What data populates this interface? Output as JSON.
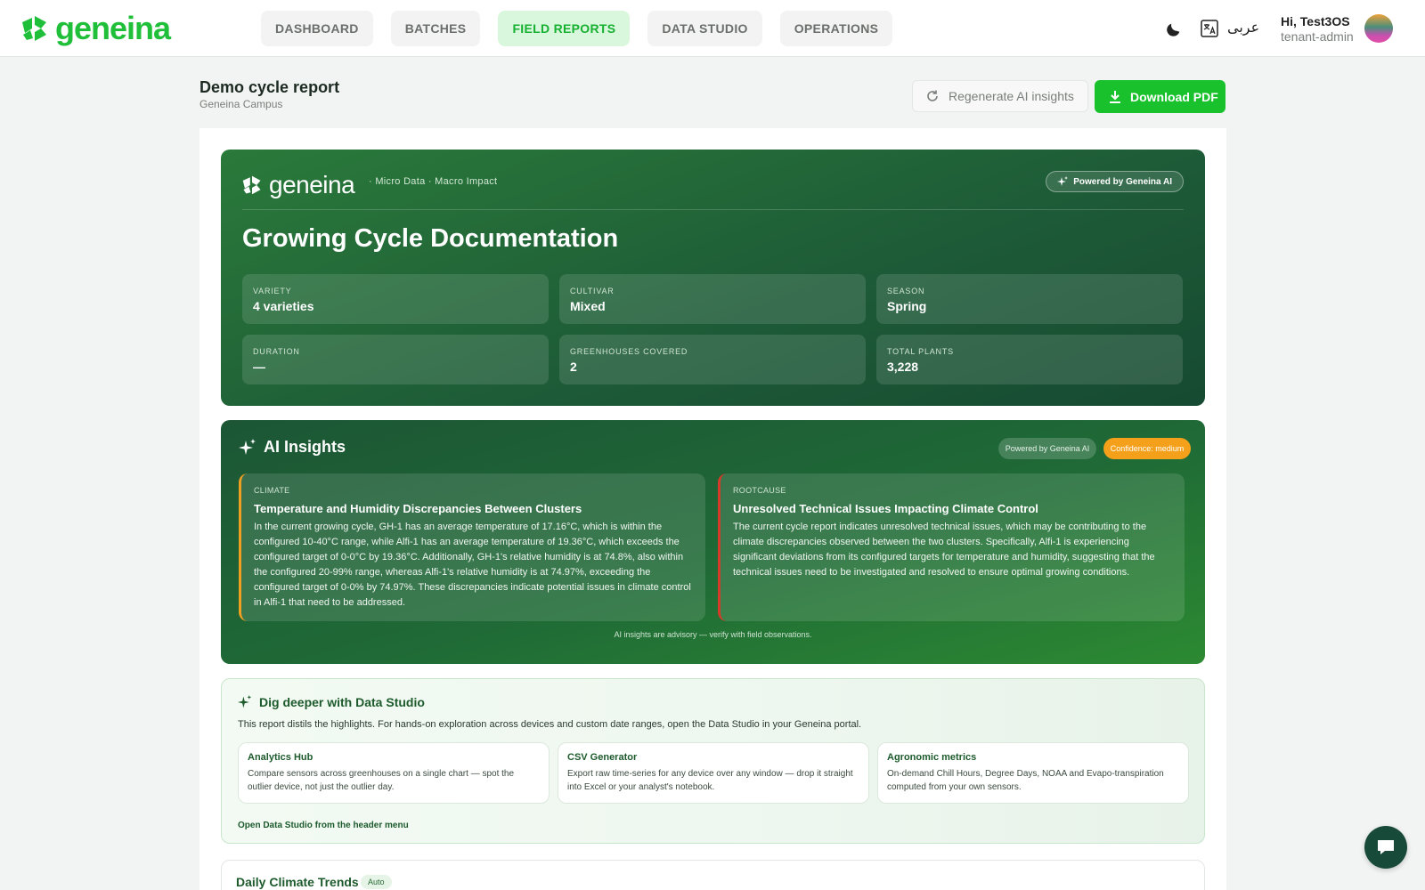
{
  "app": {
    "brand": "geneina",
    "nav": [
      {
        "label": "DASHBOARD"
      },
      {
        "label": "BATCHES"
      },
      {
        "label": "FIELD REPORTS",
        "active": true
      },
      {
        "label": "DATA STUDIO"
      },
      {
        "label": "OPERATIONS"
      }
    ],
    "language": "عربی",
    "user": {
      "greeting": "Hi, Test3OS",
      "role": "tenant-admin"
    },
    "accent": "#1fbf3a"
  },
  "page": {
    "title": "Demo cycle report",
    "subtitle": "Geneina Campus",
    "regen_label": "Regenerate AI insights",
    "pdf_label": "Download PDF"
  },
  "hero": {
    "brand": "geneina",
    "tagline": "· Micro Data · Macro Impact",
    "pill": "Powered by Geneina AI",
    "title": "Growing Cycle Documentation",
    "stats": [
      {
        "label": "VARIETY",
        "value": "4 varieties"
      },
      {
        "label": "CULTIVAR",
        "value": "Mixed"
      },
      {
        "label": "SEASON",
        "value": "Spring"
      },
      {
        "label": "DURATION",
        "value": "—"
      },
      {
        "label": "GREENHOUSES COVERED",
        "value": "2"
      },
      {
        "label": "TOTAL PLANTS",
        "value": "3,228"
      }
    ]
  },
  "ai": {
    "title": "AI Insights",
    "badge_powered": "Powered by Geneina AI",
    "badge_confidence": "Confidence: medium",
    "insights": [
      {
        "category": "CLIMATE",
        "title": "Temperature and Humidity Discrepancies Between Clusters",
        "body": "In the current growing cycle, GH-1 has an average temperature of 17.16°C, which is within the configured 10-40°C range, while Alfi-1 has an average temperature of 19.36°C, which exceeds the configured target of 0-0°C by 19.36°C. Additionally, GH-1's relative humidity is at 74.8%, also within the configured 20-99% range, whereas Alfi-1's relative humidity is at 74.97%, exceeding the configured target of 0-0% by 74.97%. These discrepancies indicate potential issues in climate control in Alfi-1 that need to be addressed."
      },
      {
        "category": "ROOTCAUSE",
        "title": "Unresolved Technical Issues Impacting Climate Control",
        "body": "The current cycle report indicates unresolved technical issues, which may be contributing to the climate discrepancies observed between the two clusters. Specifically, Alfi-1 is experiencing significant deviations from its configured targets for temperature and humidity, suggesting that the technical issues need to be investigated and resolved to ensure optimal growing conditions."
      }
    ],
    "footnote": "AI insights are advisory — verify with field observations."
  },
  "data_studio": {
    "title": "Dig deeper with Data Studio",
    "description": "This report distils the highlights. For hands-on exploration across devices and custom date ranges, open the Data Studio in your Geneina portal.",
    "cards": [
      {
        "title": "Analytics Hub",
        "body": "Compare sensors across greenhouses on a single chart — spot the outlier device, not just the outlier day."
      },
      {
        "title": "CSV Generator",
        "body": "Export raw time-series for any device over any window — drop it straight into Excel or your analyst's notebook."
      },
      {
        "title": "Agronomic metrics",
        "body": "On-demand Chill Hours, Degree Days, NOAA and Evapo-transpiration computed from your own sensors."
      }
    ],
    "link": "Open Data Studio from the header menu"
  },
  "trends": {
    "title": "Daily Climate Trends",
    "badge": "Auto"
  }
}
